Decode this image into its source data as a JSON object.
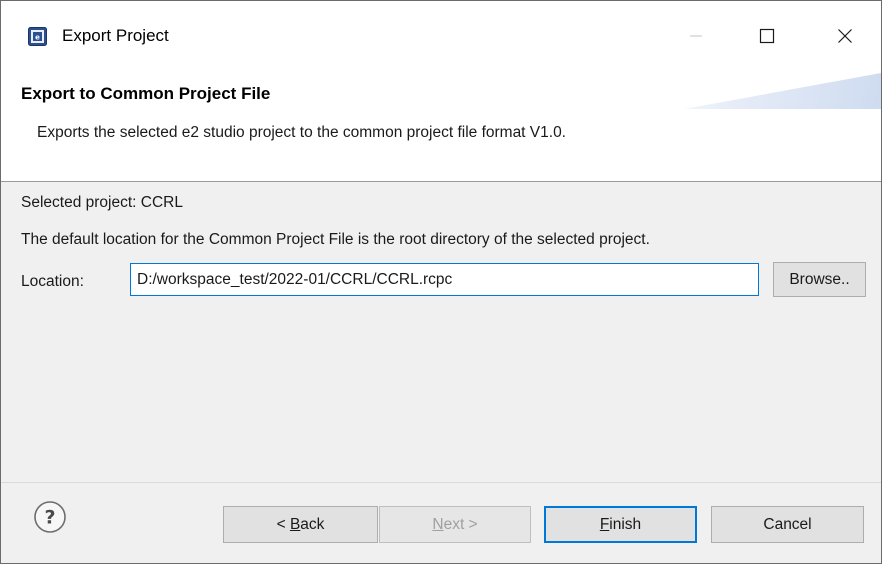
{
  "window": {
    "title": "Export Project",
    "icon": "e2-studio-app-icon",
    "controls": {
      "minimize": "minimize-icon",
      "maximize": "maximize-icon",
      "close": "close-icon"
    }
  },
  "banner": {
    "title": "Export to Common Project File",
    "description": "Exports the selected e2 studio project to the common project file format V1.0."
  },
  "content": {
    "selected_project": "Selected project: CCRL",
    "default_location_note": "The default location for the Common Project File is the root directory of the selected project.",
    "location_label": "Location:",
    "location_value": "D:/workspace_test/2022-01/CCRL/CCRL.rcpc",
    "browse_label": "Browse.."
  },
  "buttons": {
    "help_icon": "help-icon",
    "back_prefix": "< ",
    "back_mnemonic": "B",
    "back_rest": "ack",
    "next_mnemonic": "N",
    "next_rest": "ext >",
    "finish_mnemonic": "F",
    "finish_rest": "inish",
    "cancel_label": "Cancel"
  },
  "colors": {
    "accent": "#0078d7",
    "button_face": "#e1e1e1",
    "panel_background": "#f0f0f0",
    "disabled_text": "#a0a0a0"
  }
}
